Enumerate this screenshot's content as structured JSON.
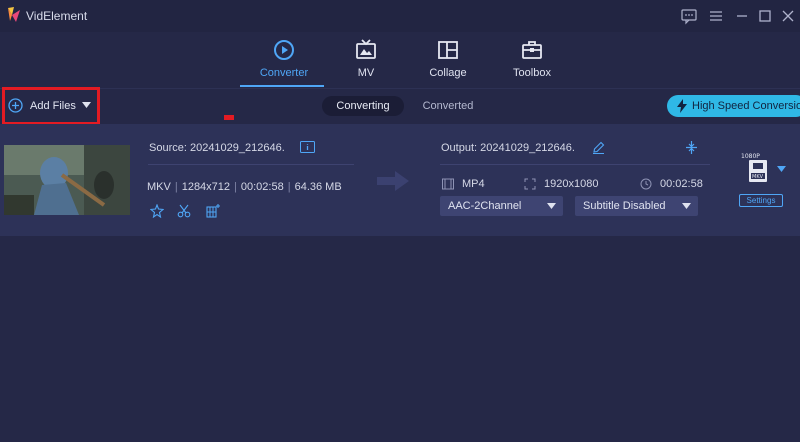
{
  "app": {
    "title": "VidElement"
  },
  "colors": {
    "accent": "#4fa6f6",
    "background": "#252847",
    "row": "#2d3258",
    "highlight": "#e31b23",
    "speed": "#2fb8e6"
  },
  "nav": {
    "tabs": [
      {
        "label": "Converter",
        "icon": "converter-icon",
        "active": true
      },
      {
        "label": "MV",
        "icon": "mv-icon"
      },
      {
        "label": "Collage",
        "icon": "collage-icon"
      },
      {
        "label": "Toolbox",
        "icon": "toolbox-icon"
      }
    ]
  },
  "toolbar": {
    "add_files": "Add Files",
    "converting": "Converting",
    "converted": "Converted",
    "high_speed": "High Speed Conversion"
  },
  "file": {
    "source": "Source: 20241029_212646.",
    "format": "MKV",
    "resolution": "1284x712",
    "duration": "00:02:58",
    "size": "64.36 MB",
    "output": "Output: 20241029_212646.",
    "out_format": "MP4",
    "out_resolution": "1920x1080",
    "out_duration": "00:02:58",
    "audio": "AAC-2Channel",
    "subtitle": "Subtitle Disabled",
    "format_badge_top": "1080P",
    "format_badge_bottom": "MKV",
    "settings": "Settings"
  }
}
